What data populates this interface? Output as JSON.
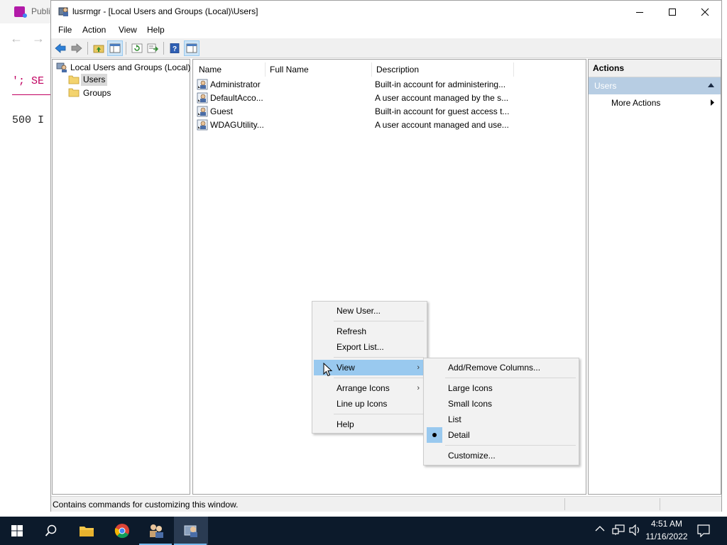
{
  "background_browser": {
    "tab_label": "Publi",
    "line1": "'; SE",
    "line2": "500 I"
  },
  "window": {
    "title": "lusrmgr - [Local Users and Groups (Local)\\Users]",
    "menu": [
      "File",
      "Action",
      "View",
      "Help"
    ]
  },
  "tree": {
    "root": "Local Users and Groups (Local)",
    "items": [
      "Users",
      "Groups"
    ]
  },
  "list": {
    "columns": [
      "Name",
      "Full Name",
      "Description"
    ],
    "rows": [
      {
        "name": "Administrator",
        "full_name": "",
        "description": "Built-in account for administering..."
      },
      {
        "name": "DefaultAcco...",
        "full_name": "",
        "description": "A user account managed by the s..."
      },
      {
        "name": "Guest",
        "full_name": "",
        "description": "Built-in account for guest access t..."
      },
      {
        "name": "WDAGUtility...",
        "full_name": "",
        "description": "A user account managed and use..."
      }
    ]
  },
  "actions": {
    "title": "Actions",
    "section": "Users",
    "more": "More Actions"
  },
  "context_menu": {
    "items": [
      "New User...",
      "Refresh",
      "Export List...",
      "View",
      "Arrange Icons",
      "Line up Icons",
      "Help"
    ],
    "highlighted": "View"
  },
  "view_submenu": {
    "items": [
      "Add/Remove Columns...",
      "Large Icons",
      "Small Icons",
      "List",
      "Detail",
      "Customize..."
    ],
    "selected": "Detail"
  },
  "status_text": "Contains commands for customizing this window.",
  "taskbar": {
    "time": "4:51 AM",
    "date": "11/16/2022"
  },
  "colors": {
    "accent": "#99c9ef",
    "actions_section": "#b7cde3",
    "taskbar": "#0c1a2b"
  }
}
